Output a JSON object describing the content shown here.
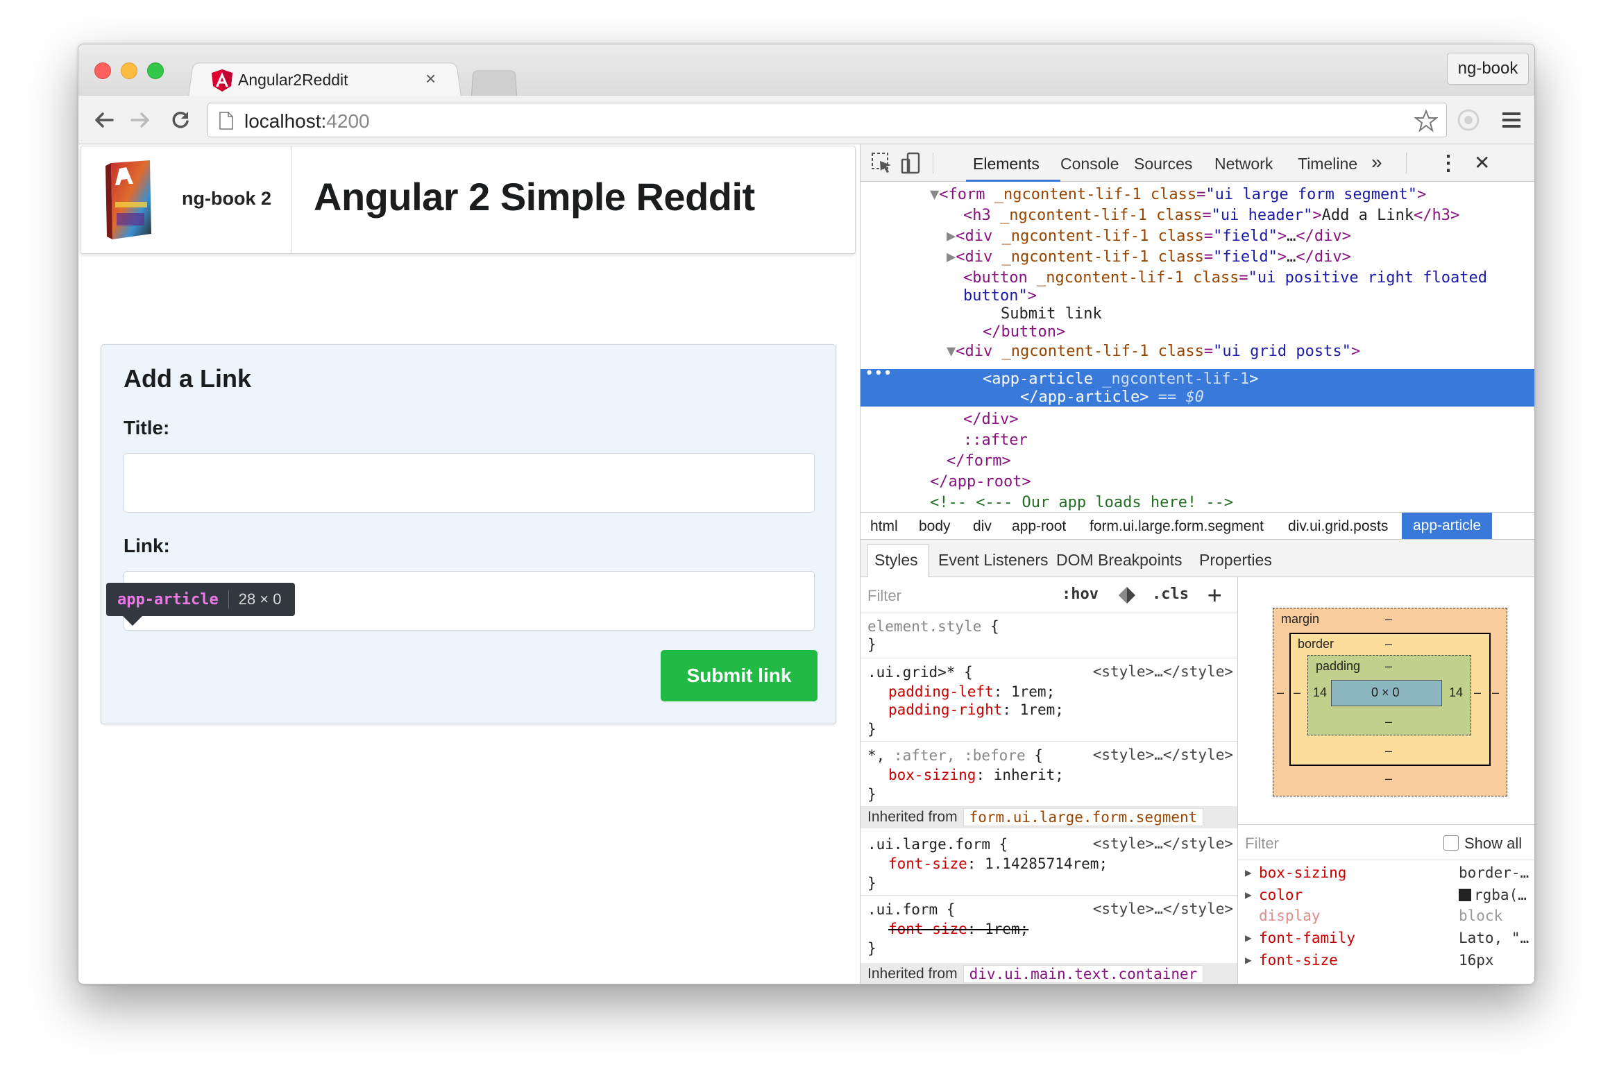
{
  "browser": {
    "tab_title": "Angular2Reddit",
    "tab_close": "×",
    "profile_label": "ng-book",
    "url_host": "localhost:",
    "url_port": "4200"
  },
  "page": {
    "brand": "ng-book 2",
    "site_title": "Angular 2 Simple Reddit",
    "form": {
      "heading": "Add a Link",
      "title_label": "Title:",
      "title_value": "",
      "link_label": "Link:",
      "link_value": "",
      "submit_label": "Submit link"
    },
    "tooltip": {
      "tag": "app-article",
      "size": "28 × 0"
    }
  },
  "devtools": {
    "tabs": [
      "Elements",
      "Console",
      "Sources",
      "Network",
      "Timeline",
      "»"
    ],
    "more": "⋮",
    "close": "✕",
    "ellipsis": "…",
    "breadcrumbs": [
      "html",
      "body",
      "div",
      "app-root",
      "form.ui.large.form.segment",
      "div.ui.grid.posts",
      "app-article"
    ],
    "style_tabs": [
      "Styles",
      "Event Listeners",
      "DOM Breakpoints",
      "Properties"
    ],
    "styles_filter_placeholder": "Filter",
    "hov": ":hov",
    "cls": ".cls",
    "plus": "+",
    "inherited_prefix": "Inherited from",
    "inherited_1": "form.ui.large.form.segment",
    "inherited_2": "div.ui.main.text.container",
    "style_source": "<style>…</style>",
    "box_model": {
      "margin_label": "margin",
      "border_label": "border",
      "padding_label": "padding",
      "content": "0 × 0",
      "padding_left": "14",
      "padding_right": "14",
      "dash": "–"
    },
    "computed_filter_placeholder": "Filter",
    "show_all": "Show all",
    "computed": [
      {
        "name": "box-sizing",
        "value": "border-…"
      },
      {
        "name": "color",
        "value": "rgba(…"
      },
      {
        "name": "display",
        "value": "block"
      },
      {
        "name": "font-family",
        "value": "Lato, \"…"
      },
      {
        "name": "font-size",
        "value": "16px"
      }
    ],
    "colors": {
      "selection": "#3879d9",
      "tag": "#881280",
      "attr": "#994500",
      "value": "#1a1aa6",
      "prop": "#c80000"
    }
  }
}
